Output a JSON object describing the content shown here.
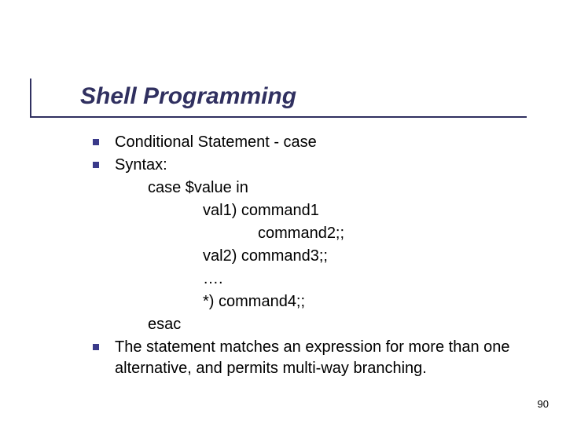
{
  "slide": {
    "title": "Shell Programming",
    "bullets": {
      "b1": "Conditional Statement - case",
      "b2": "Syntax:",
      "syntax": {
        "l1": "case  $value  in",
        "l2": "val1)  command1",
        "l3": "command2;;",
        "l4": "val2)  command3;;",
        "l5": "….",
        "l6": "*)   command4;;",
        "l7": "esac"
      },
      "b3": "The statement matches an expression for more than one alternative, and permits multi-way branching."
    },
    "page_number": "90"
  }
}
